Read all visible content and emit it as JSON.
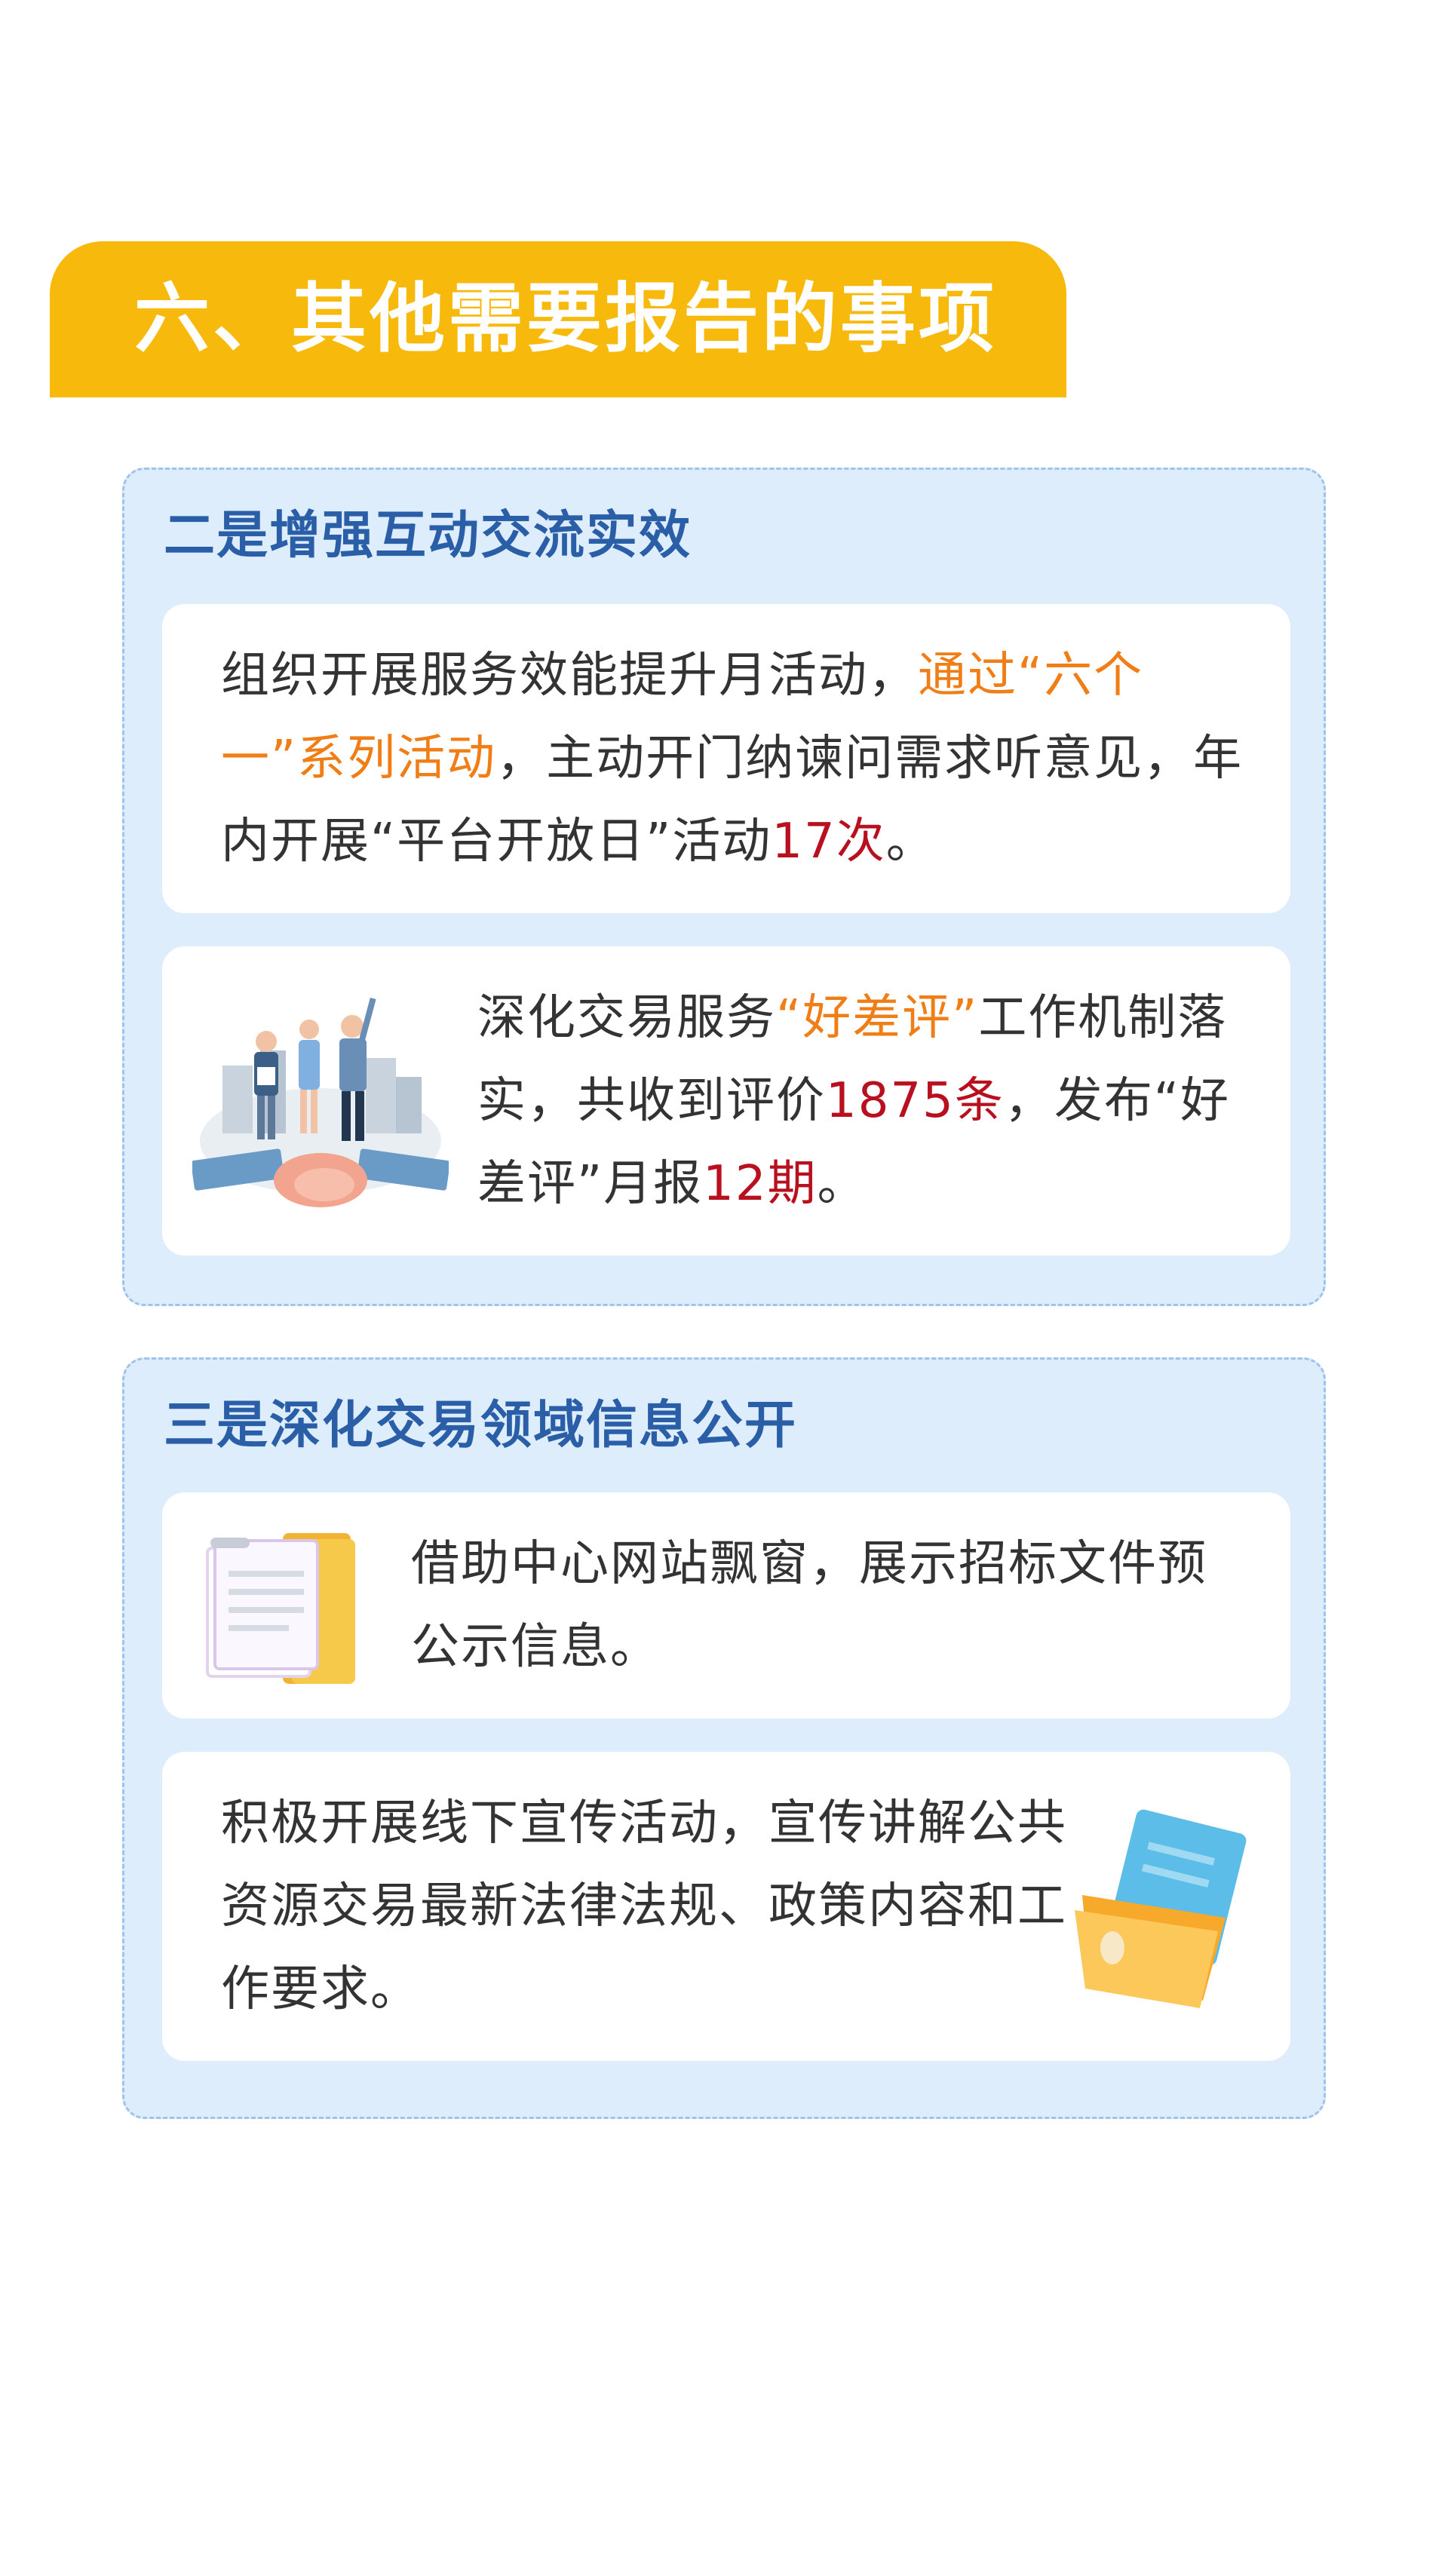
{
  "section": {
    "title": "六、其他需要报告的事项"
  },
  "panels": [
    {
      "title": "二是增强互动交流实效",
      "cards": [
        {
          "parts": [
            "组织开展服务效能提升月活动，",
            "通过“六个一”系列活动",
            "，主动开门纳谏问需求听意见，年内开展“平台开放日”活动",
            "17次",
            "。"
          ],
          "icon": "none"
        },
        {
          "parts": [
            "深化交易服务",
            "“好差评”",
            "工作机制落实，共收到评价",
            "1875条",
            "，发布“好差评”月报",
            "12期",
            "。"
          ],
          "icon": "people-handshake-illustration"
        }
      ]
    },
    {
      "title": "三是深化交易领域信息公开",
      "cards": [
        {
          "parts": [
            "借助中心网站飘窗，展示招标文件预公示信息。"
          ],
          "icon": "document-folder-illustration"
        },
        {
          "parts": [
            "积极开展线下宣传活动，宣传讲解公共资源交易最新法律法规、政策内容和工作要求。"
          ],
          "icon": "open-folder-illustration"
        }
      ]
    }
  ],
  "colors": {
    "banner": "#f7b90b",
    "panel_bg": "#deedfb",
    "panel_border": "#9ec3ec",
    "panel_title": "#2a5fa8",
    "highlight_orange": "#f07d16",
    "highlight_red": "#b8101e"
  }
}
